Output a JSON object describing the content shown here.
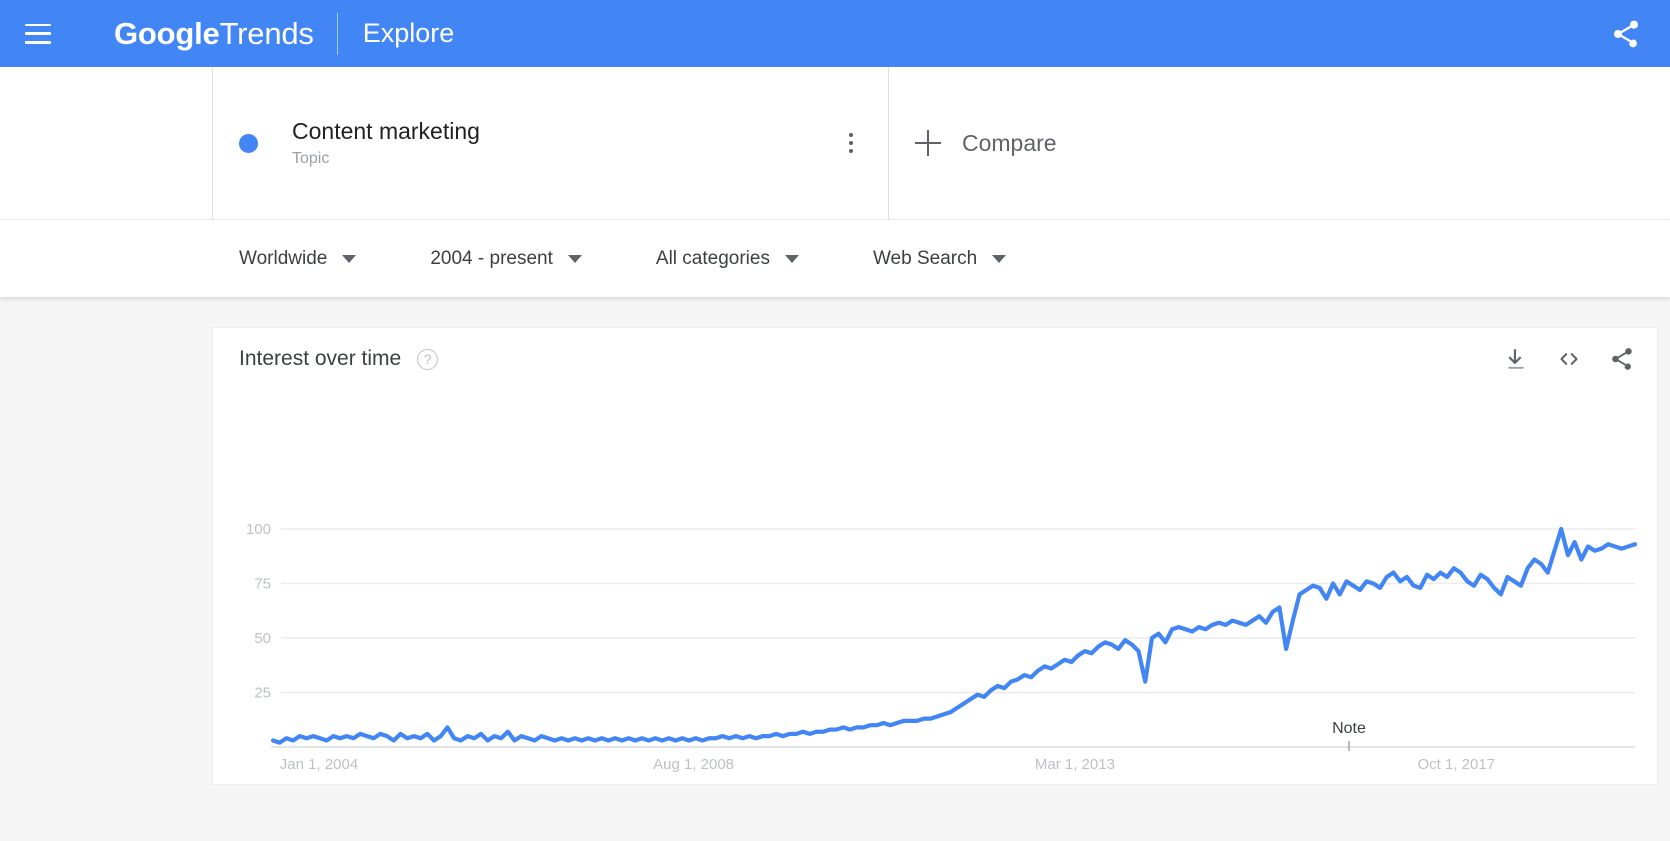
{
  "header": {
    "menu_icon": "hamburger-icon",
    "brand_primary": "Google",
    "brand_secondary": "Trends",
    "nav_label": "Explore",
    "share_icon": "share-icon"
  },
  "query": {
    "term_title": "Content marketing",
    "term_type": "Topic",
    "term_color": "#4285f4",
    "menu_icon": "more-vertical-icon",
    "compare_label": "Compare",
    "compare_icon": "plus-icon"
  },
  "filters": [
    {
      "label": "Worldwide",
      "name": "region-filter"
    },
    {
      "label": "2004 - present",
      "name": "time-filter"
    },
    {
      "label": "All categories",
      "name": "category-filter"
    },
    {
      "label": "Web Search",
      "name": "search-type-filter"
    }
  ],
  "card": {
    "title": "Interest over time",
    "help_icon": "help-circle-icon",
    "help_glyph": "?",
    "download_icon": "download-icon",
    "embed_icon": "embed-code-icon",
    "share_icon": "share-icon"
  },
  "chart_data": {
    "type": "line",
    "title": "Interest over time",
    "xlabel": "",
    "ylabel": "",
    "ylim": [
      0,
      100
    ],
    "yticks": [
      25,
      50,
      75,
      100
    ],
    "grid": true,
    "legend_position": "none",
    "line_color": "#4285f4",
    "xtick_labels": [
      "Jan 1, 2004",
      "Aug 1, 2008",
      "Mar 1, 2013",
      "Oct 1, 2017"
    ],
    "xtick_positions": [
      0,
      0.275,
      0.555,
      0.835
    ],
    "annotations": [
      {
        "label": "Note",
        "x_fraction": 0.79
      }
    ],
    "series": [
      {
        "name": "Content marketing",
        "color": "#4285f4",
        "values": [
          3,
          2,
          4,
          3,
          5,
          4,
          5,
          4,
          3,
          5,
          4,
          5,
          4,
          6,
          5,
          4,
          6,
          5,
          3,
          6,
          4,
          5,
          4,
          6,
          3,
          5,
          9,
          4,
          3,
          5,
          4,
          6,
          3,
          5,
          4,
          7,
          3,
          5,
          4,
          3,
          5,
          4,
          3,
          4,
          3,
          4,
          3,
          4,
          3,
          4,
          3,
          4,
          3,
          4,
          3,
          4,
          3,
          4,
          3,
          4,
          3,
          4,
          3,
          4,
          3,
          4,
          4,
          5,
          4,
          5,
          4,
          5,
          4,
          5,
          5,
          6,
          5,
          6,
          6,
          7,
          6,
          7,
          7,
          8,
          8,
          9,
          8,
          9,
          9,
          10,
          10,
          11,
          10,
          11,
          12,
          12,
          12,
          13,
          13,
          14,
          15,
          16,
          18,
          20,
          22,
          24,
          23,
          26,
          28,
          27,
          30,
          31,
          33,
          32,
          35,
          37,
          36,
          38,
          40,
          39,
          42,
          44,
          43,
          46,
          48,
          47,
          45,
          49,
          47,
          44,
          30,
          50,
          52,
          48,
          54,
          55,
          54,
          53,
          55,
          54,
          56,
          57,
          56,
          58,
          57,
          56,
          58,
          60,
          57,
          62,
          64,
          45,
          58,
          70,
          72,
          74,
          73,
          68,
          75,
          70,
          76,
          74,
          72,
          76,
          75,
          73,
          78,
          80,
          76,
          78,
          74,
          73,
          79,
          77,
          80,
          78,
          82,
          80,
          76,
          74,
          79,
          77,
          73,
          70,
          78,
          76,
          74,
          82,
          86,
          84,
          80,
          90,
          100,
          88,
          94,
          86,
          92,
          90,
          91,
          93,
          92,
          91,
          92,
          93
        ]
      }
    ]
  }
}
